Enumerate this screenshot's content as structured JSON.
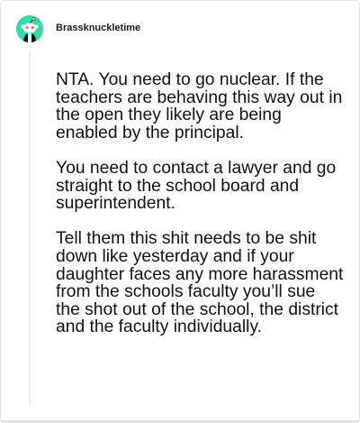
{
  "comment": {
    "author": "Brassknuckletime",
    "avatar_icon": "snoo-avatar-icon",
    "avatar_color": "#2ee0a6",
    "paragraphs": [
      "NTA. You need to go nuclear. If the teachers are behaving this way out in the open they likely are being enabled by the principal.",
      "You need to contact a lawyer and go straight to the school board and superintendent.",
      "Tell them this shit needs to be shit down like yesterday and if your daughter faces any more harassment from the schools faculty you’ll sue the shot out of the school, the district and the faculty individually."
    ]
  }
}
